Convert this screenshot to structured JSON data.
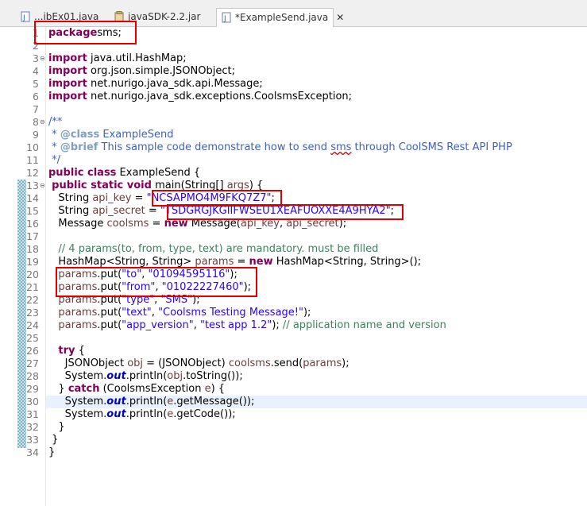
{
  "tabs": [
    {
      "label": "...ibEx01.java",
      "active": false
    },
    {
      "label": "javaSDK-2.2.jar",
      "active": false
    },
    {
      "label": "*ExampleSend.java",
      "active": true
    }
  ],
  "close_icon": "close-icon",
  "colors": {
    "keyword": "#7f0055",
    "string": "#2a00ff",
    "comment": "#3f7f5f",
    "javadoc": "#3f5fbf",
    "highlight_box": "#e00000"
  },
  "editor": {
    "lines": [
      {
        "n": "1",
        "tokens": [
          [
            "kw",
            "package"
          ],
          [
            "",
            "sms;"
          ]
        ]
      },
      {
        "n": "2",
        "tokens": []
      },
      {
        "n": "3",
        "tokens": [
          [
            "kw",
            "import"
          ],
          [
            "",
            " java.util.HashMap;"
          ]
        ],
        "fold": true
      },
      {
        "n": "4",
        "tokens": [
          [
            "kw",
            "import"
          ],
          [
            "",
            " org.json.simple.JSONObject;"
          ]
        ]
      },
      {
        "n": "5",
        "tokens": [
          [
            "kw",
            "import"
          ],
          [
            "",
            " net.nurigo.java_sdk.api.Message;"
          ]
        ]
      },
      {
        "n": "6",
        "tokens": [
          [
            "kw",
            "import"
          ],
          [
            "",
            " net.nurigo.java_sdk.exceptions.CoolsmsException;"
          ]
        ]
      },
      {
        "n": "7",
        "tokens": []
      },
      {
        "n": "8",
        "tokens": [
          [
            "doc",
            "/**"
          ]
        ],
        "fold": true
      },
      {
        "n": "9",
        "tokens": [
          [
            "doc",
            " * "
          ],
          [
            "tag",
            "@class"
          ],
          [
            "doc",
            " ExampleSend"
          ]
        ]
      },
      {
        "n": "10",
        "tokens": [
          [
            "doc",
            " * "
          ],
          [
            "tag",
            "@brief"
          ],
          [
            "doc",
            " This sample code demonstrate how to send "
          ],
          [
            "docerr",
            "sms"
          ],
          [
            "doc",
            " through CoolSMS Rest API PHP"
          ]
        ]
      },
      {
        "n": "11",
        "tokens": [
          [
            "doc",
            " */"
          ]
        ]
      },
      {
        "n": "12",
        "tokens": [
          [
            "kw",
            "public class"
          ],
          [
            "",
            " ExampleSend {"
          ]
        ]
      },
      {
        "n": "13",
        "tokens": [
          [
            "",
            " "
          ],
          [
            "kw",
            "public static void"
          ],
          [
            "",
            " main(String[] "
          ],
          [
            "var",
            "args"
          ],
          [
            "",
            ") {"
          ]
        ],
        "fold": true
      },
      {
        "n": "14",
        "tokens": [
          [
            "",
            "   String "
          ],
          [
            "var",
            "api_key"
          ],
          [
            "",
            " = "
          ],
          [
            "str",
            "\"NCSAPMO4M9FKQ7Z7\""
          ],
          [
            "",
            ";"
          ]
        ]
      },
      {
        "n": "15",
        "tokens": [
          [
            "",
            "   String "
          ],
          [
            "var",
            "api_secret"
          ],
          [
            "",
            " = "
          ],
          [
            "str",
            "\"TSDGRGJKGIIFWSEU1XEAFUOXXE4A9HYA2\""
          ],
          [
            "",
            ";"
          ]
        ]
      },
      {
        "n": "16",
        "tokens": [
          [
            "",
            "   Message "
          ],
          [
            "var",
            "coolsms"
          ],
          [
            "",
            " = "
          ],
          [
            "kw",
            "new"
          ],
          [
            "",
            " Message("
          ],
          [
            "var",
            "api_key"
          ],
          [
            "",
            ", "
          ],
          [
            "var",
            "api_secret"
          ],
          [
            "",
            ");"
          ]
        ]
      },
      {
        "n": "17",
        "tokens": []
      },
      {
        "n": "18",
        "tokens": [
          [
            "com",
            "   // 4 params(to, from, type, text) are mandatory. must be filled"
          ]
        ]
      },
      {
        "n": "19",
        "tokens": [
          [
            "",
            "   HashMap<String, String> "
          ],
          [
            "var",
            "params"
          ],
          [
            "",
            " = "
          ],
          [
            "kw",
            "new"
          ],
          [
            "",
            " HashMap<String, String>();"
          ]
        ]
      },
      {
        "n": "20",
        "tokens": [
          [
            "",
            "   "
          ],
          [
            "var",
            "params"
          ],
          [
            "",
            ".put("
          ],
          [
            "str",
            "\"to\""
          ],
          [
            "",
            ", "
          ],
          [
            "str",
            "\"01094595116\""
          ],
          [
            "",
            ");"
          ]
        ]
      },
      {
        "n": "21",
        "tokens": [
          [
            "",
            "   "
          ],
          [
            "var",
            "params"
          ],
          [
            "",
            ".put("
          ],
          [
            "str",
            "\"from\""
          ],
          [
            "",
            ", "
          ],
          [
            "str",
            "\"01022227460\""
          ],
          [
            "",
            ");"
          ]
        ]
      },
      {
        "n": "22",
        "tokens": [
          [
            "",
            "   "
          ],
          [
            "var",
            "params"
          ],
          [
            "",
            ".put("
          ],
          [
            "str",
            "\"type\""
          ],
          [
            "",
            ", "
          ],
          [
            "str",
            "\"SMS\""
          ],
          [
            "",
            ");"
          ]
        ]
      },
      {
        "n": "23",
        "tokens": [
          [
            "",
            "   "
          ],
          [
            "var",
            "params"
          ],
          [
            "",
            ".put("
          ],
          [
            "str",
            "\"text\""
          ],
          [
            "",
            ", "
          ],
          [
            "str",
            "\"Coolsms Testing Message!\""
          ],
          [
            "",
            ");"
          ]
        ]
      },
      {
        "n": "24",
        "tokens": [
          [
            "",
            "   "
          ],
          [
            "var",
            "params"
          ],
          [
            "",
            ".put("
          ],
          [
            "str",
            "\"app_version\""
          ],
          [
            "",
            ", "
          ],
          [
            "str",
            "\"test app 1.2\""
          ],
          [
            "",
            "); "
          ],
          [
            "com",
            "// application name and version"
          ]
        ]
      },
      {
        "n": "25",
        "tokens": []
      },
      {
        "n": "26",
        "tokens": [
          [
            "",
            "   "
          ],
          [
            "kw",
            "try"
          ],
          [
            "",
            " {"
          ]
        ]
      },
      {
        "n": "27",
        "tokens": [
          [
            "",
            "     JSONObject "
          ],
          [
            "var",
            "obj"
          ],
          [
            "",
            " = (JSONObject) "
          ],
          [
            "var",
            "coolsms"
          ],
          [
            "",
            ".send("
          ],
          [
            "var",
            "params"
          ],
          [
            "",
            ");"
          ]
        ]
      },
      {
        "n": "28",
        "tokens": [
          [
            "",
            "     System."
          ],
          [
            "field",
            "out"
          ],
          [
            "",
            ".println("
          ],
          [
            "var",
            "obj"
          ],
          [
            "",
            ".toString());"
          ]
        ]
      },
      {
        "n": "29",
        "tokens": [
          [
            "",
            "   } "
          ],
          [
            "kw",
            "catch"
          ],
          [
            "",
            " (CoolsmsException "
          ],
          [
            "var",
            "e"
          ],
          [
            "",
            ") {"
          ]
        ]
      },
      {
        "n": "30",
        "tokens": [
          [
            "",
            "     System."
          ],
          [
            "field",
            "out"
          ],
          [
            "",
            ".println("
          ],
          [
            "var",
            "e"
          ],
          [
            "",
            ".getMessage());"
          ]
        ],
        "current": true
      },
      {
        "n": "31",
        "tokens": [
          [
            "",
            "     System."
          ],
          [
            "field",
            "out"
          ],
          [
            "",
            ".println("
          ],
          [
            "var",
            "e"
          ],
          [
            "",
            ".getCode());"
          ]
        ]
      },
      {
        "n": "32",
        "tokens": [
          [
            "",
            "   }"
          ]
        ]
      },
      {
        "n": "33",
        "tokens": [
          [
            "",
            " }"
          ]
        ]
      },
      {
        "n": "34",
        "tokens": [
          [
            "",
            "}"
          ]
        ]
      }
    ]
  }
}
